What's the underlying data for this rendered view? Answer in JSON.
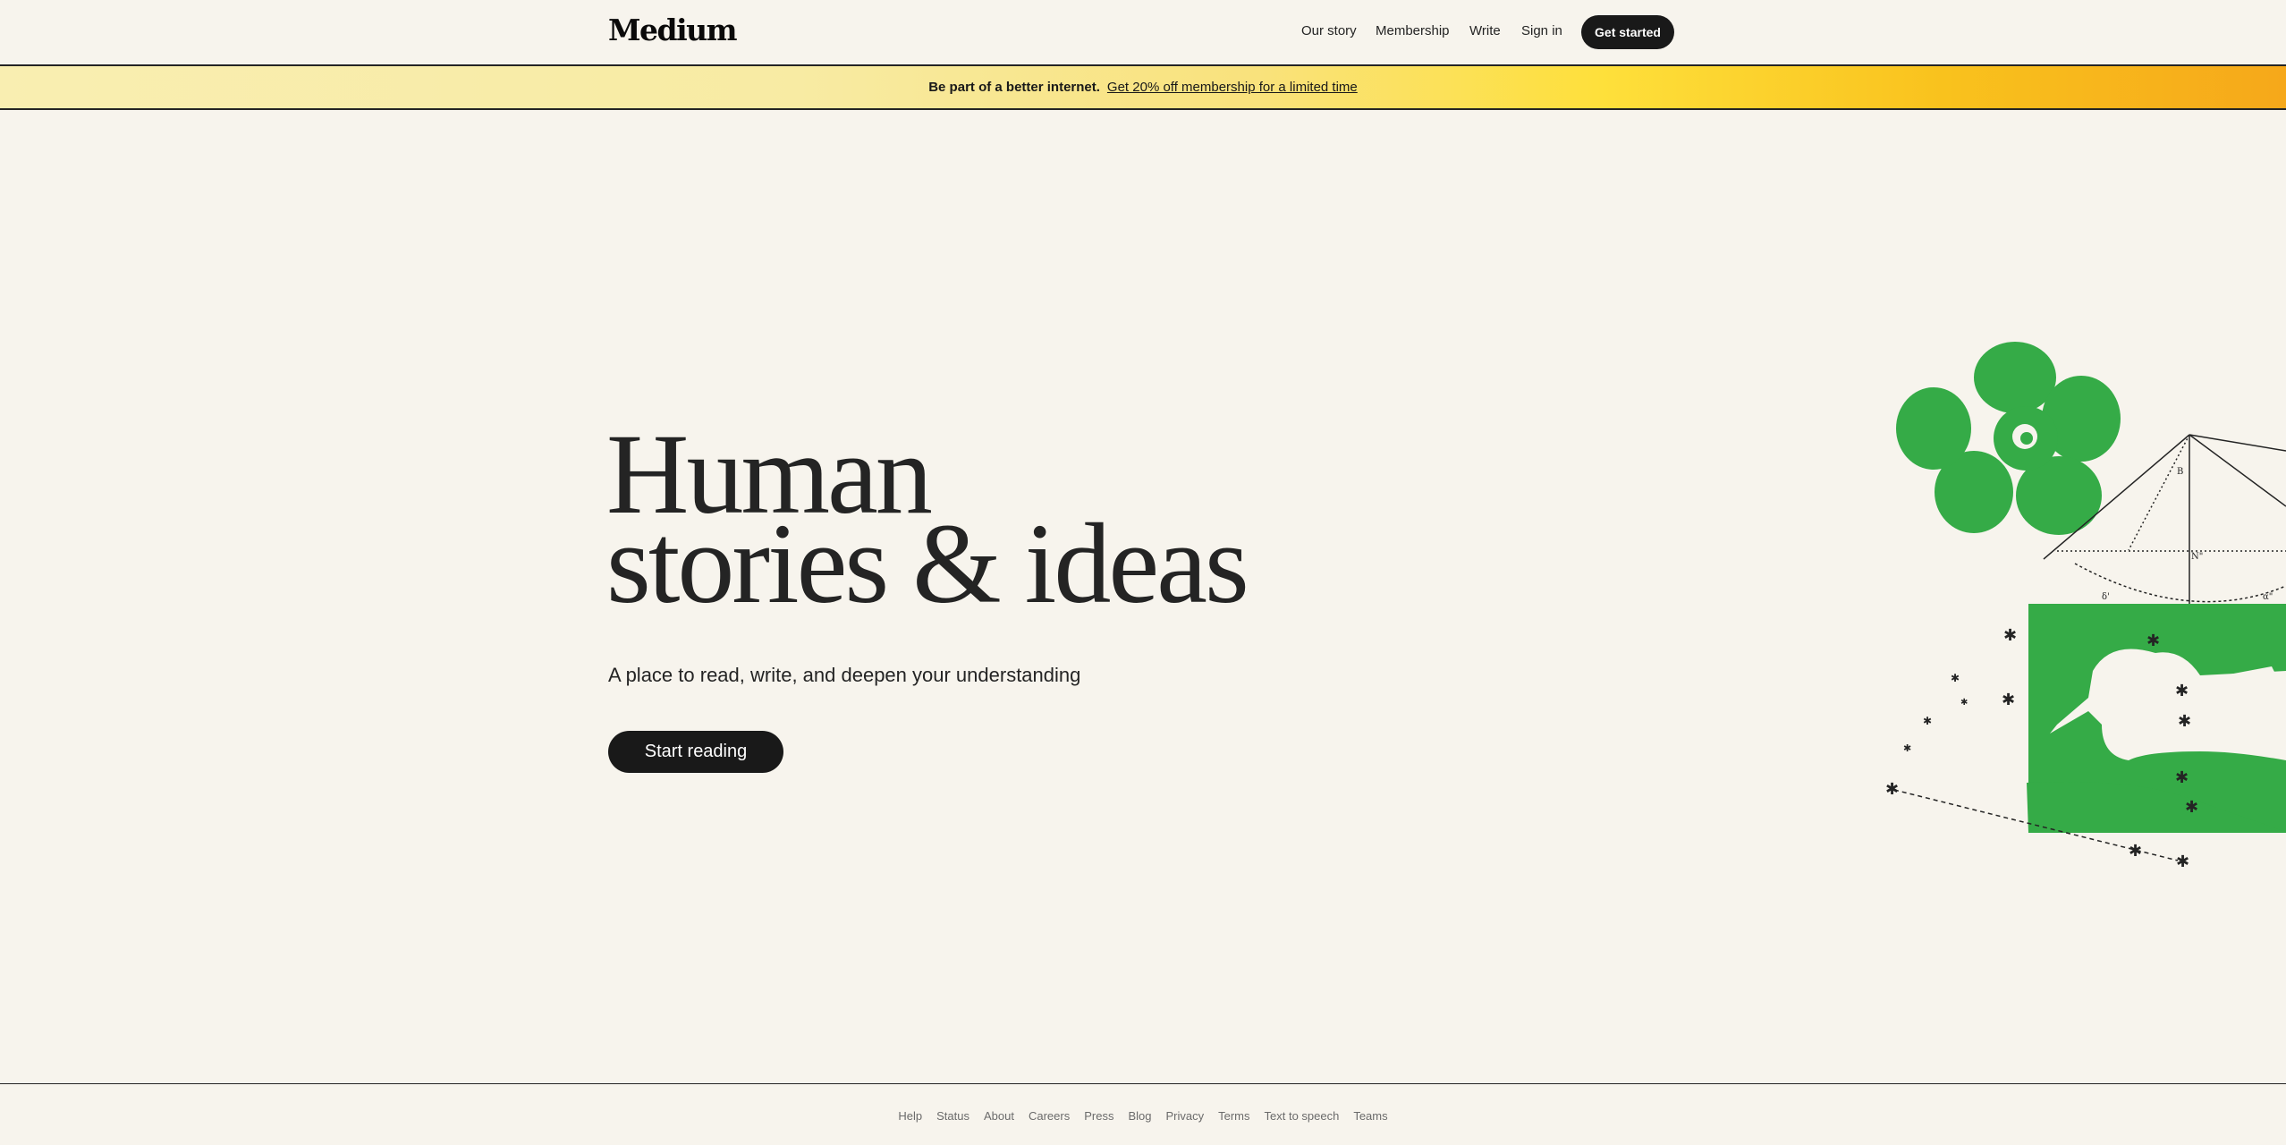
{
  "header": {
    "logo": "Medium",
    "nav": {
      "our_story": "Our story",
      "membership": "Membership",
      "write": "Write",
      "sign_in": "Sign in"
    },
    "cta": "Get started"
  },
  "banner": {
    "lead": "Be part of a better internet.",
    "link": "Get 20% off membership for a limited time"
  },
  "hero": {
    "title_line1": "Human",
    "title_line2": "stories & ideas",
    "subtitle": "A place to read, write, and deepen your understanding",
    "cta": "Start reading"
  },
  "footer": {
    "links": [
      "Help",
      "Status",
      "About",
      "Careers",
      "Press",
      "Blog",
      "Privacy",
      "Terms",
      "Text to speech",
      "Teams"
    ]
  },
  "colors": {
    "background": "#f7f4ed",
    "ink": "#242424",
    "button": "#191919",
    "accent_green": "#35ab47",
    "banner_yellow": "#fee03b",
    "banner_orange": "#f6a81a"
  }
}
